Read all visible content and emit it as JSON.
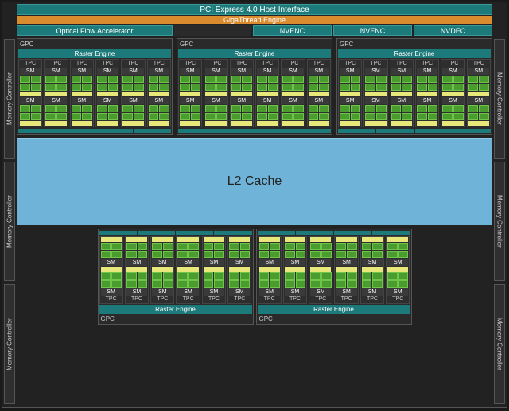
{
  "top": {
    "pci": "PCI Express 4.0 Host Interface",
    "giga": "GigaThread Engine",
    "ofa": "Optical Flow Accelerator",
    "nvenc1": "NVENC",
    "nvenc2": "NVENC",
    "nvdec": "NVDEC"
  },
  "labels": {
    "gpc": "GPC",
    "raster": "Raster Engine",
    "tpc": "TPC",
    "sm": "SM",
    "memctrl": "Memory Controller",
    "l2": "L2 Cache"
  },
  "colors": {
    "teal": "#1d7a7a",
    "orange": "#d98b2e",
    "l2": "#6fb4d8",
    "core": "#4a9c2f",
    "tensor": "#e8e87a",
    "bg": "#222"
  },
  "structure": {
    "gpc_count_top": 3,
    "gpc_count_bottom": 2,
    "tpc_per_gpc": 6,
    "sm_per_tpc": 2,
    "mem_controllers_per_side": 3
  }
}
